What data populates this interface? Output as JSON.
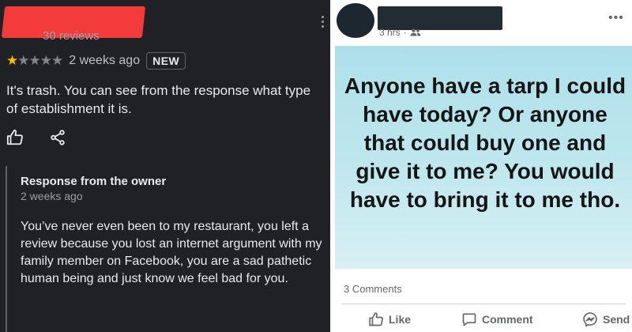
{
  "review": {
    "reviews_count": "30 reviews",
    "rating": 1,
    "max_rating": 5,
    "time_ago": "2 weeks ago",
    "badge": "NEW",
    "text": "It's trash. You can see from the response what type of establishment it is.",
    "owner_response": {
      "title": "Response from the owner",
      "time_ago": "2 weeks ago",
      "text": "You’ve never even been to my restaurant, you left a review because you lost an internet argument with my family member on Facebook, you are a sad pathetic human being and just know we feel bad for you."
    }
  },
  "post": {
    "time": "3 hrs",
    "separator": "·",
    "text": "Anyone have a tarp I could have today? Or anyone that could buy one and give it to me? You would have to bring it to me tho.",
    "comments_count": "3 Comments",
    "actions": {
      "like": "Like",
      "comment": "Comment",
      "send": "Send"
    }
  },
  "colors": {
    "review_bg": "#202124",
    "star_filled": "#fbbc04",
    "redaction_red": "#f43b3b",
    "post_bg_top": "#aee0ea",
    "post_bg_bottom": "#d9f0f3"
  }
}
